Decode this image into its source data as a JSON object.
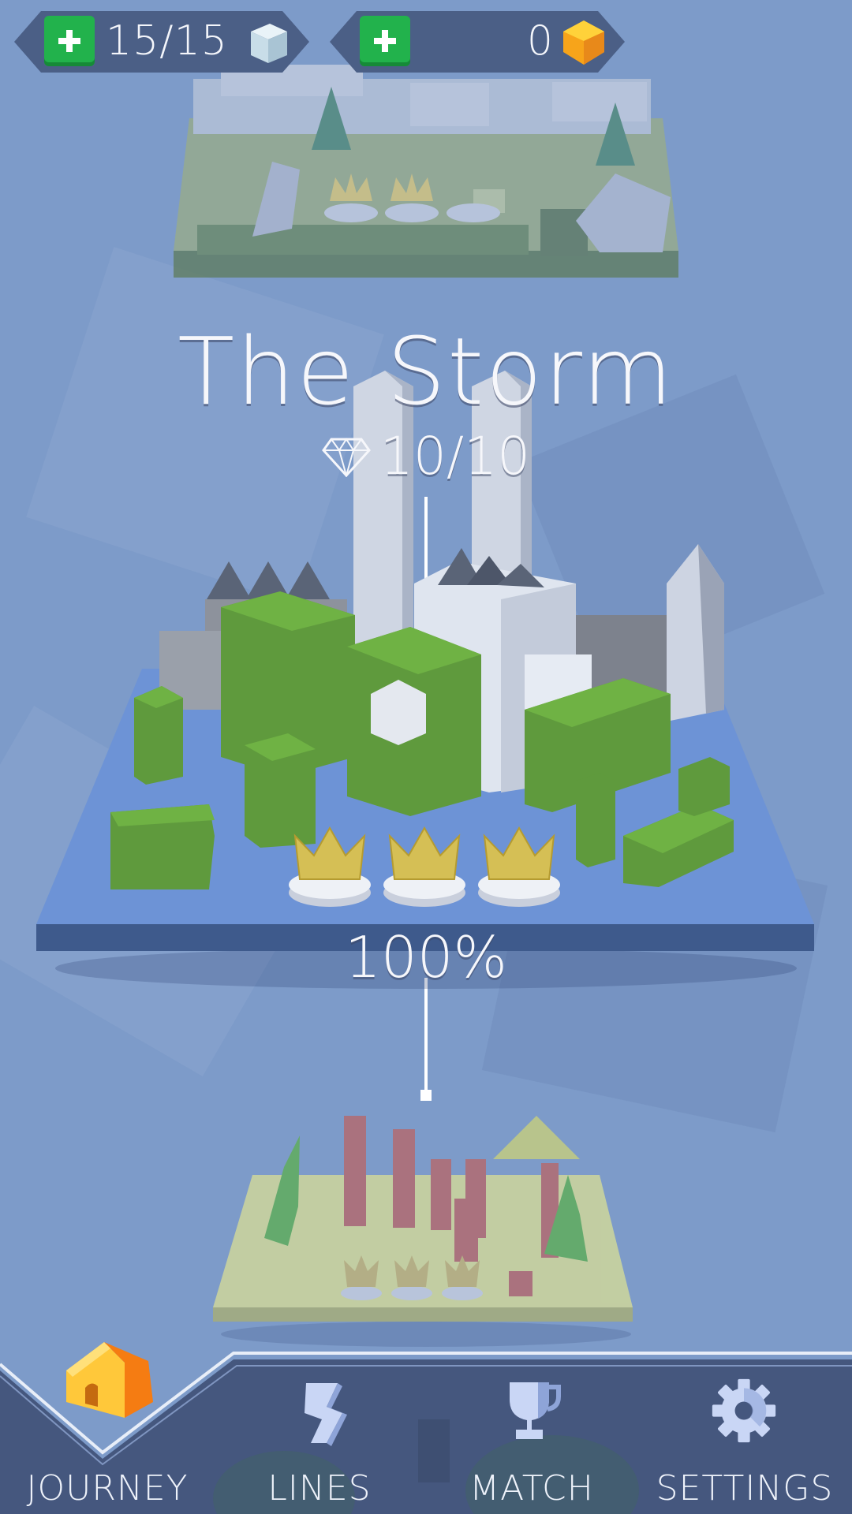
{
  "hud": {
    "lives": "15/15",
    "gems": "0",
    "add_lives_icon": "plus-icon",
    "add_gems_icon": "plus-icon",
    "lives_icon": "ice-cube-icon",
    "gems_icon": "gold-gem-icon"
  },
  "level": {
    "title": "The Storm",
    "diamonds": "10/10",
    "diamond_icon": "diamond-icon",
    "progress": "100%",
    "crowns_earned": 3
  },
  "nav": {
    "items": [
      {
        "label": "JOURNEY",
        "icon": "house-icon",
        "active": true
      },
      {
        "label": "LINES",
        "icon": "lines-icon",
        "active": false
      },
      {
        "label": "MATCH",
        "icon": "trophy-icon",
        "active": false
      },
      {
        "label": "SETTINGS",
        "icon": "gear-icon",
        "active": false
      }
    ]
  },
  "colors": {
    "background": "#7d9bc9",
    "hud": "#4b5f86",
    "plus_button": "#22b24c",
    "nav_bar": "#45577e",
    "active_house": "#ff9a1f"
  }
}
